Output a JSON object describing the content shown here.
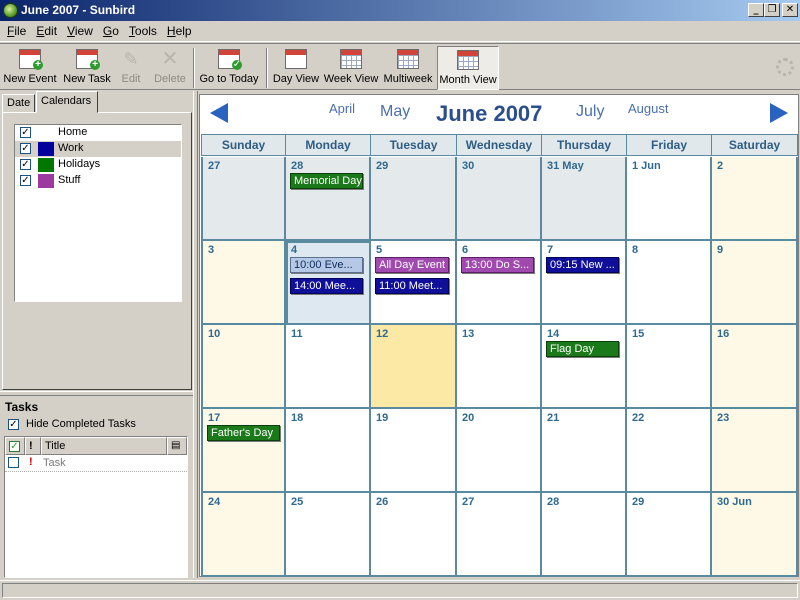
{
  "window": {
    "title": "June 2007 - Sunbird",
    "minimize": "_",
    "maximize": "❐",
    "close": "✕"
  },
  "menu": [
    {
      "label": "File",
      "key": "F"
    },
    {
      "label": "Edit",
      "key": "E"
    },
    {
      "label": "View",
      "key": "V"
    },
    {
      "label": "Go",
      "key": "G"
    },
    {
      "label": "Tools",
      "key": "T"
    },
    {
      "label": "Help",
      "key": "H"
    }
  ],
  "toolbar": {
    "new_event": "New Event",
    "new_task": "New Task",
    "edit": "Edit",
    "delete": "Delete",
    "go_to_today": "Go to Today",
    "day_view": "Day View",
    "week_view": "Week View",
    "multiweek": "Multiweek",
    "month_view": "Month View"
  },
  "left_tabs": {
    "date": "Date",
    "calendars": "Calendars"
  },
  "calendars": [
    {
      "name": "Home",
      "color": "#ffffff",
      "checked": "✓"
    },
    {
      "name": "Work",
      "color": "#00009c",
      "checked": "✓"
    },
    {
      "name": "Holidays",
      "color": "#007700",
      "checked": "✓"
    },
    {
      "name": "Stuff",
      "color": "#9c3aa0",
      "checked": "✓"
    }
  ],
  "tasks": {
    "title": "Tasks",
    "hide_completed": "Hide Completed Tasks",
    "hide_completed_checked": "✓",
    "col_title": "Title",
    "col_priority": "!",
    "items": [
      {
        "priority": "!",
        "name": "Task"
      }
    ]
  },
  "month_nav": {
    "prev2": "April",
    "prev1": "May",
    "current": "June 2007",
    "next1": "July",
    "next2": "August"
  },
  "weekdays": [
    "Sunday",
    "Monday",
    "Tuesday",
    "Wednesday",
    "Thursday",
    "Friday",
    "Saturday"
  ],
  "weeks": [
    [
      {
        "label": "27",
        "kind": "othermonth",
        "events": []
      },
      {
        "label": "28",
        "kind": "othermonth",
        "events": [
          {
            "text": "Memorial Day",
            "cal": "holiday"
          }
        ]
      },
      {
        "label": "29",
        "kind": "othermonth",
        "events": []
      },
      {
        "label": "30",
        "kind": "othermonth",
        "events": []
      },
      {
        "label": "31 May",
        "kind": "othermonth",
        "events": []
      },
      {
        "label": "1 Jun",
        "kind": "weekday",
        "events": []
      },
      {
        "label": "2",
        "kind": "weekend",
        "events": []
      }
    ],
    [
      {
        "label": "3",
        "kind": "weekend",
        "events": []
      },
      {
        "label": "4",
        "kind": "selected",
        "events": [
          {
            "text": "10:00  Eve...",
            "cal": "home"
          },
          {
            "text": "14:00  Mee...",
            "cal": "work"
          }
        ]
      },
      {
        "label": "5",
        "kind": "weekday",
        "events": [
          {
            "text": "All Day Event",
            "cal": "stuff"
          },
          {
            "text": "11:00  Meet...",
            "cal": "work"
          }
        ]
      },
      {
        "label": "6",
        "kind": "weekday",
        "events": [
          {
            "text": "13:00  Do S...",
            "cal": "stuff"
          }
        ]
      },
      {
        "label": "7",
        "kind": "weekday",
        "events": [
          {
            "text": "09:15  New ...",
            "cal": "work"
          }
        ]
      },
      {
        "label": "8",
        "kind": "weekday",
        "events": []
      },
      {
        "label": "9",
        "kind": "weekend",
        "events": []
      }
    ],
    [
      {
        "label": "10",
        "kind": "weekend",
        "events": []
      },
      {
        "label": "11",
        "kind": "weekday",
        "events": []
      },
      {
        "label": "12",
        "kind": "today",
        "events": []
      },
      {
        "label": "13",
        "kind": "weekday",
        "events": []
      },
      {
        "label": "14",
        "kind": "weekday",
        "events": [
          {
            "text": "Flag Day",
            "cal": "holiday"
          }
        ]
      },
      {
        "label": "15",
        "kind": "weekday",
        "events": []
      },
      {
        "label": "16",
        "kind": "weekend",
        "events": []
      }
    ],
    [
      {
        "label": "17",
        "kind": "weekend",
        "events": [
          {
            "text": "Father's Day",
            "cal": "holiday"
          }
        ]
      },
      {
        "label": "18",
        "kind": "weekday",
        "events": []
      },
      {
        "label": "19",
        "kind": "weekday",
        "events": []
      },
      {
        "label": "20",
        "kind": "weekday",
        "events": []
      },
      {
        "label": "21",
        "kind": "weekday",
        "events": []
      },
      {
        "label": "22",
        "kind": "weekday",
        "events": []
      },
      {
        "label": "23",
        "kind": "weekend",
        "events": []
      }
    ],
    [
      {
        "label": "24",
        "kind": "weekend",
        "events": []
      },
      {
        "label": "25",
        "kind": "weekday",
        "events": []
      },
      {
        "label": "26",
        "kind": "weekday",
        "events": []
      },
      {
        "label": "27",
        "kind": "weekday",
        "events": []
      },
      {
        "label": "28",
        "kind": "weekday",
        "events": []
      },
      {
        "label": "29",
        "kind": "weekday",
        "events": []
      },
      {
        "label": "30 Jun",
        "kind": "weekend",
        "events": []
      }
    ]
  ]
}
